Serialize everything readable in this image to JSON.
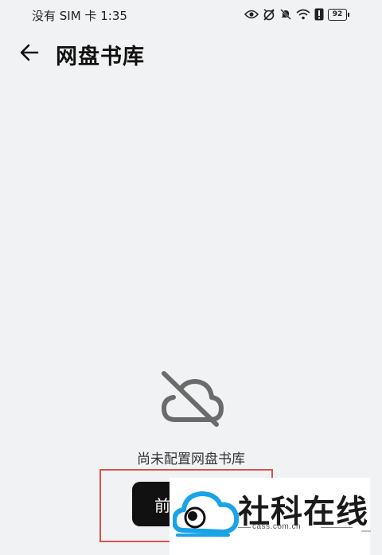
{
  "status_bar": {
    "carrier": "没有 SIM 卡",
    "time": "1:35",
    "battery": "92",
    "icons": [
      "eye-icon",
      "alarm-off-icon",
      "mute-icon",
      "wifi-icon",
      "alert-icon",
      "battery-icon"
    ]
  },
  "header": {
    "back_icon": "arrow-left-icon",
    "title": "网盘书库"
  },
  "empty_state": {
    "icon": "cloud-off-icon",
    "message": "尚未配置网盘书库",
    "button_label": "前"
  },
  "watermark": {
    "text": "社科在线",
    "url": "cass.com.cn"
  },
  "colors": {
    "background": "#f1f2f4",
    "button": "#111111",
    "highlight": "#d9534f",
    "icon_gray": "#6b6b6b"
  }
}
